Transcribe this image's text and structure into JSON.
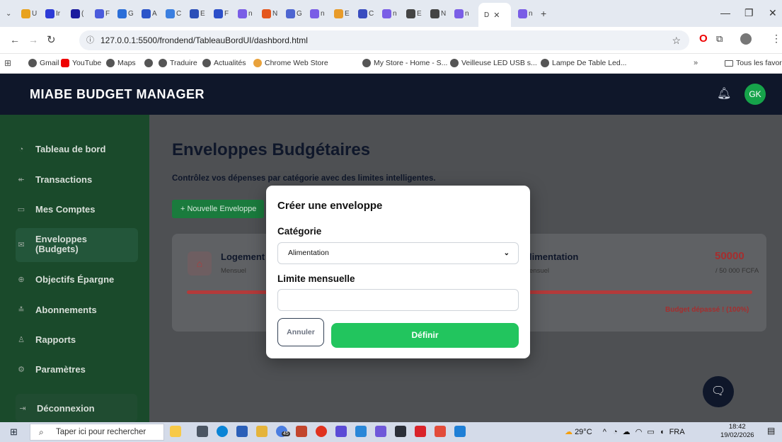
{
  "browser": {
    "tabs": [
      {
        "label": "U"
      },
      {
        "label": "Ir"
      },
      {
        "label": "("
      },
      {
        "label": "F"
      },
      {
        "label": "G"
      },
      {
        "label": "A"
      },
      {
        "label": "C"
      },
      {
        "label": "E"
      },
      {
        "label": "F"
      },
      {
        "label": "n"
      },
      {
        "label": "N"
      },
      {
        "label": "G"
      },
      {
        "label": "n"
      },
      {
        "label": "E"
      },
      {
        "label": "C"
      },
      {
        "label": "n"
      },
      {
        "label": "E"
      },
      {
        "label": "N"
      },
      {
        "label": "n"
      },
      {
        "label": "D"
      },
      {
        "label": "n"
      }
    ],
    "url": "127.0.0.1:5500/frondend/TableauBordUI/dashbord.html",
    "bookmarks": [
      "Gmail",
      "YouTube",
      "Maps",
      "Traduire",
      "Actualités",
      "Chrome Web Store",
      "My Store - Home - S...",
      "Veilleuse LED USB s...",
      "Lampe De Table Led..."
    ],
    "all_bookmarks": "Tous les favoris"
  },
  "app": {
    "brand": "MIABE BUDGET MANAGER",
    "avatar": "GK"
  },
  "sidebar": {
    "items": [
      {
        "label": "Tableau de bord",
        "icon": "dashboard-icon"
      },
      {
        "label": "Transactions",
        "icon": "arrow-icon"
      },
      {
        "label": "Mes Comptes",
        "icon": "card-icon"
      },
      {
        "label": "Enveloppes",
        "label2": "(Budgets)",
        "icon": "envelope-icon"
      },
      {
        "label": "Objectifs Épargne",
        "icon": "target-icon"
      },
      {
        "label": "Abonnements",
        "icon": "subscription-icon"
      },
      {
        "label": "Rapports",
        "icon": "report-icon"
      },
      {
        "label": "Paramètres",
        "icon": "settings-icon"
      }
    ],
    "logout": "Déconnexion"
  },
  "main": {
    "title": "Enveloppes Budgétaires",
    "subtitle": "Contrôlez vos dépenses par catégorie avec des limites intelligentes.",
    "new_button": "+ Nouvelle Enveloppe",
    "cards": [
      {
        "title": "Logement",
        "period": "Mensuel"
      },
      {
        "title": "limentation",
        "period": "ensuel",
        "amount": "50000",
        "limit": "/ 50 000 FCFA",
        "status": "Budget dépassé ! (100%)",
        "progress": 1.0
      }
    ]
  },
  "modal": {
    "title": "Créer une enveloppe",
    "category_label": "Catégorie",
    "category_value": "Alimentation",
    "limit_label": "Limite mensuelle",
    "limit_value": "",
    "cancel": "Annuler",
    "confirm": "Définir"
  },
  "taskbar": {
    "search_placeholder": "Taper ici pour rechercher",
    "weather": "29°C",
    "lang": "FRA",
    "time": "18:42",
    "date": "19/02/2026",
    "badge": "45"
  },
  "colors": {
    "header": "#0f172a",
    "sidebar": "#1a4a2b",
    "accent_green": "#22c55e",
    "danger": "#b33a3a"
  }
}
